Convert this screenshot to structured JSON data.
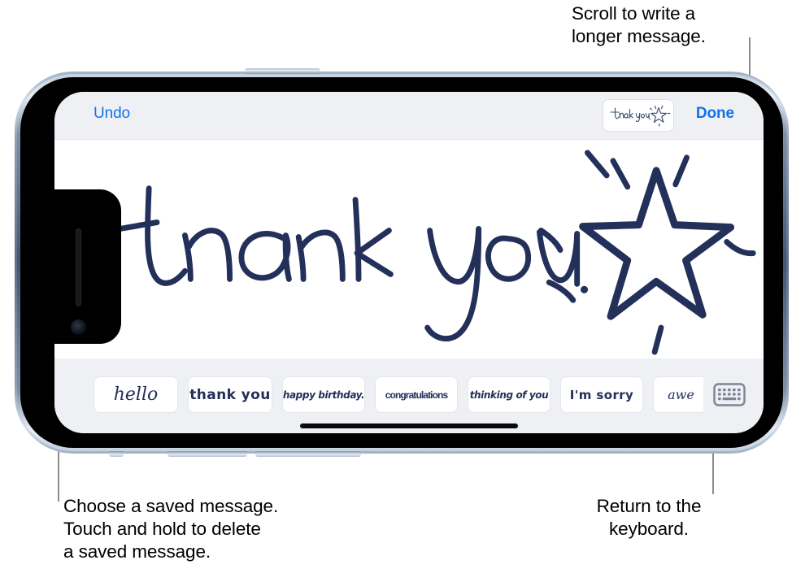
{
  "callouts": {
    "scroll": "Scroll to write a\nlonger message.",
    "choose": "Choose a saved message.\nTouch and hold to delete\na saved message.",
    "keyboard": "Return to the\nkeyboard."
  },
  "device": {
    "type": "iphone-landscape",
    "notch_side": "left"
  },
  "screen": {
    "topbar": {
      "undo_label": "Undo",
      "done_label": "Done",
      "thumbnail_label": "thank you"
    },
    "canvas": {
      "handwriting_text": "thank you",
      "drawing": "star-with-sparkles",
      "ink_color": "#23305a",
      "background": "#ffffff",
      "scroll_chevron": "chevron-right-icon"
    },
    "saved_messages": {
      "items": [
        {
          "label": "hello",
          "style": "script",
          "size": 22,
          "clipped": false
        },
        {
          "label": "thank you",
          "style": "marker",
          "size": 17,
          "clipped": false
        },
        {
          "label": "happy birthday.",
          "style": "slant",
          "size": 12,
          "clipped": false
        },
        {
          "label": "congratulations",
          "style": "narrow",
          "size": 12,
          "clipped": false
        },
        {
          "label": "thinking of you",
          "style": "slant",
          "size": 12,
          "clipped": false
        },
        {
          "label": "I'm sorry",
          "style": "marker",
          "size": 15,
          "clipped": false
        },
        {
          "label": "awe",
          "style": "script",
          "size": 16,
          "clipped": true
        }
      ],
      "keyboard_button": "keyboard-icon"
    },
    "home_indicator": true
  },
  "colors": {
    "accent_blue": "#1272ec",
    "chrome_gray": "#eff0f4",
    "ink_navy": "#23305a",
    "leader_gray": "#8c8c8c",
    "chevron_gray": "#d2d4d8"
  }
}
